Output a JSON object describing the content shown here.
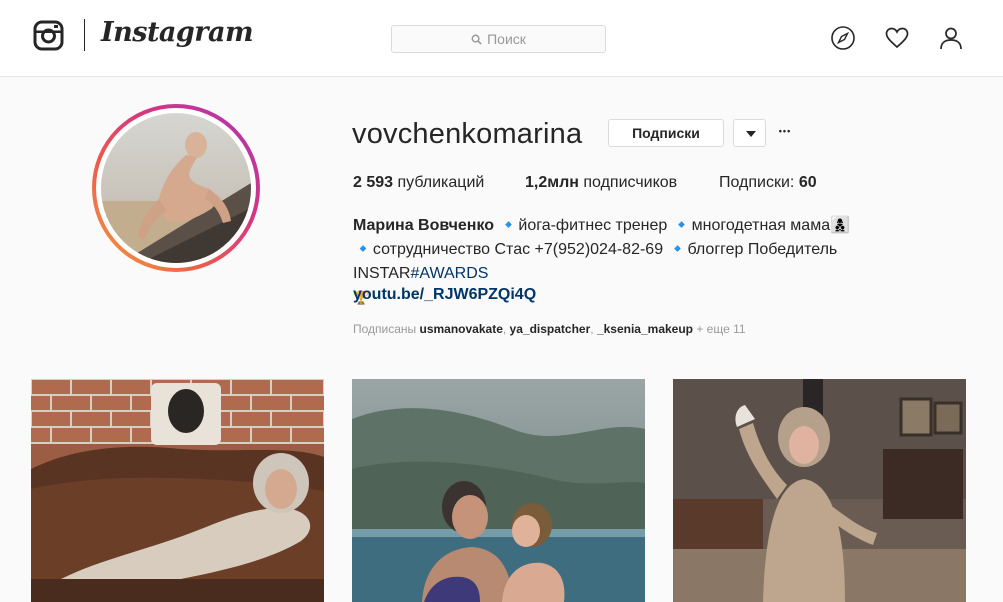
{
  "header": {
    "brand": "Instagram",
    "search_placeholder": "Поиск"
  },
  "profile": {
    "username": "vovchenkomarina",
    "following_button": "Подписки",
    "more_label": "•••",
    "stats": {
      "posts_count": "2 593",
      "posts_label": " публикаций",
      "followers_count": "1,2млн",
      "followers_label": " подписчиков",
      "following_label": "Подписки: ",
      "following_count": "60"
    },
    "bio": {
      "full_name": "Марина Вовченко",
      "line1_rest": " 🔹йога-фитнес тренер 🔹многодетная мама👩‍👦‍👦",
      "line2": "🔹сотрудничество Стас +7(952)024-82-69 🔹блоггер Победитель INSTAR",
      "hashtag": "#AWARDS",
      "line3": "🏆",
      "link": "youtu.be/_RJW6PZQi4Q"
    },
    "followed_by": {
      "prefix": "Подписаны ",
      "users": [
        "usmanovakate",
        "ya_dispatcher",
        "_ksenia_makeup"
      ],
      "suffix": " + еще 11"
    }
  },
  "colors": {
    "accent_link": "#003569",
    "text": "#262626",
    "muted": "#999999",
    "ring_gradient": [
      "#f6a23a",
      "#ea5a4e",
      "#d43583",
      "#a537b7"
    ]
  },
  "icons": [
    "instagram-glyph-icon",
    "search-icon",
    "compass-icon",
    "heart-icon",
    "person-icon",
    "chevron-down-icon",
    "more-icon"
  ]
}
